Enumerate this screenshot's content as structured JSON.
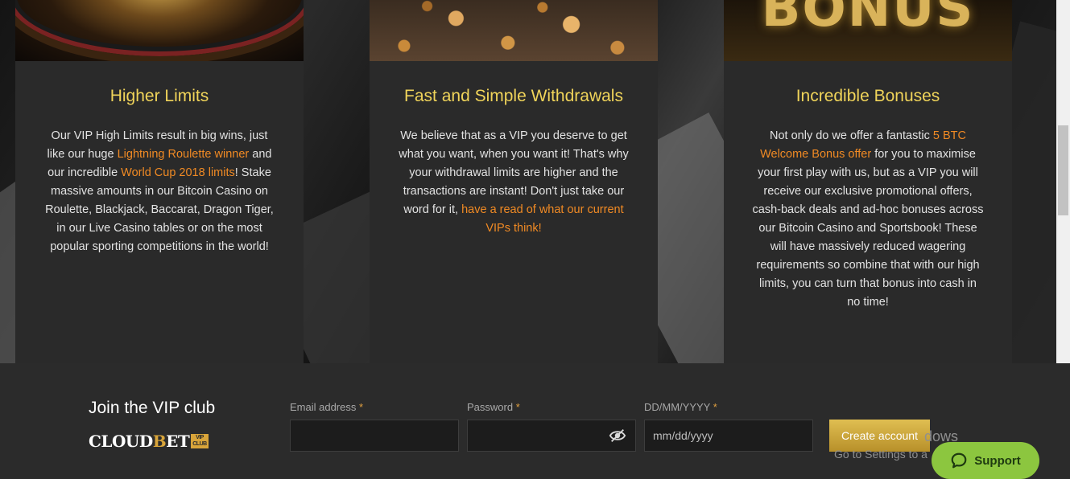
{
  "cards": [
    {
      "title": "Higher Limits",
      "body": [
        {
          "t": "Our VIP High Limits result in big wins, just like our huge "
        },
        {
          "t": "Lightning Roulette winner",
          "link": true
        },
        {
          "t": " and our incredible "
        },
        {
          "t": "World Cup 2018 limits",
          "link": true
        },
        {
          "t": "! Stake massive amounts in our Bitcoin Casino on Roulette, Blackjack, Baccarat, Dragon Tiger, in our Live Casino tables or on the most popular sporting competitions in the world!"
        }
      ]
    },
    {
      "title": "Fast and Simple Withdrawals",
      "body": [
        {
          "t": "We believe that as a VIP you deserve to get what you want, when you want it! That's why your withdrawal limits are higher and the transactions are instant! Don't just take our word for it, "
        },
        {
          "t": "have a read of what our current VIPs think!",
          "link": true
        }
      ]
    },
    {
      "title": "Incredible Bonuses",
      "image_text": "BONUS",
      "body": [
        {
          "t": "Not only do we offer a fantastic "
        },
        {
          "t": "5 BTC Welcome Bonus offer",
          "link": true
        },
        {
          "t": " for you to maximise your first play with us, but as a VIP you will receive our exclusive promotional offers, cash-back deals and ad-hoc bonuses across our Bitcoin Casino and Sportsbook! These will have massively reduced wagering requirements so combine that with our high limits, you can turn that bonus into cash in no time!"
        }
      ]
    }
  ],
  "footer": {
    "join_title": "Join the VIP club",
    "logo": {
      "text_before": "CLOUD",
      "b_letter": "B",
      "text_after": "ET",
      "badge_line1": "VIP",
      "badge_line2": "CLUB"
    },
    "email_label": "Email address",
    "password_label": "Password",
    "dob_label": "DD/MM/YYYY",
    "required_mark": "*",
    "email_value": "",
    "password_value": "",
    "dob_placeholder": "mm/dd/yyyy",
    "create_button": "Create account",
    "support_button": "Support"
  },
  "os_watermark": {
    "line1": "dows",
    "line2": "Go to Settings to a"
  },
  "colors": {
    "title_gold": "#f0d45a",
    "link_orange": "#f08a24",
    "support_green": "#8cc63f"
  }
}
